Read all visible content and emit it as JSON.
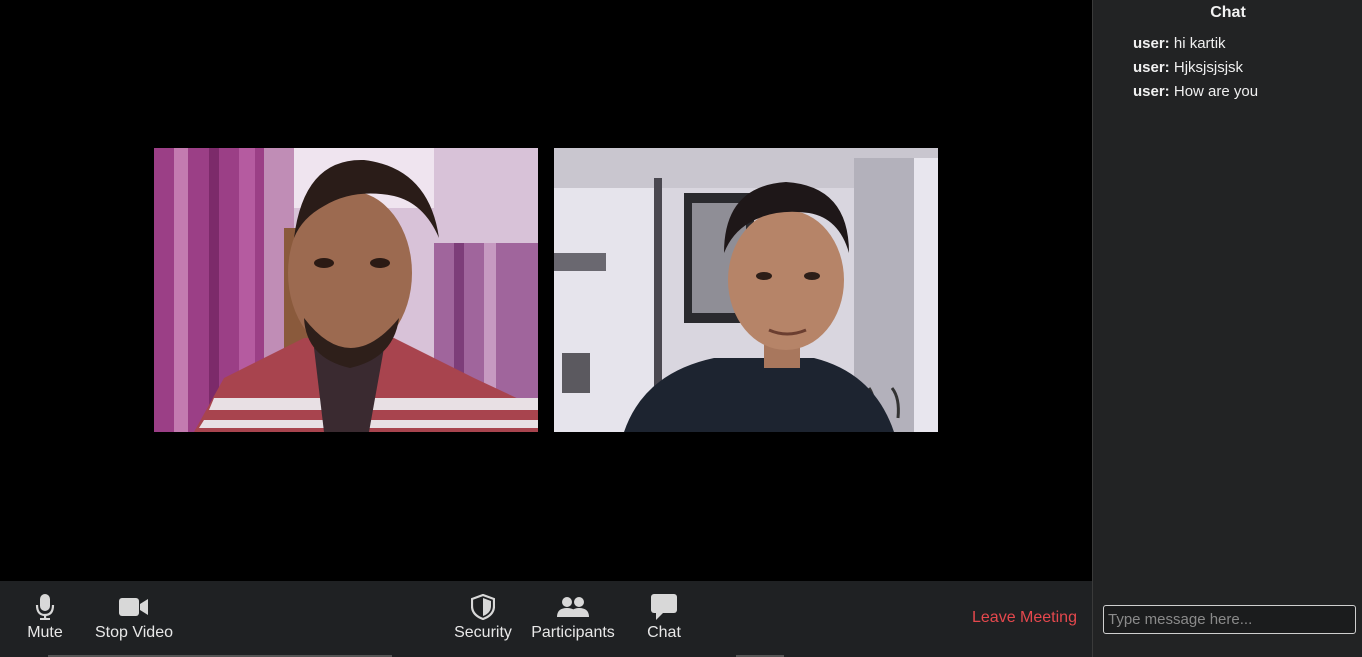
{
  "chat": {
    "title": "Chat",
    "messages": [
      {
        "user": "user:",
        "text": "hi kartik"
      },
      {
        "user": "user:",
        "text": "Hjksjsjsjsk"
      },
      {
        "user": "user:",
        "text": "How are you"
      }
    ],
    "input_placeholder": "Type message here..."
  },
  "toolbar": {
    "mute": {
      "label": "Mute",
      "icon": "microphone-icon"
    },
    "stop_video": {
      "label": "Stop Video",
      "icon": "video-camera-icon"
    },
    "security": {
      "label": "Security",
      "icon": "shield-icon"
    },
    "participants": {
      "label": "Participants",
      "icon": "people-icon"
    },
    "chat": {
      "label": "Chat",
      "icon": "chat-bubble-icon"
    },
    "leave": {
      "label": "Leave Meeting"
    }
  },
  "colors": {
    "stage_bg": "#000000",
    "toolbar_bg": "#1f2123",
    "panel_bg": "#222324",
    "leave_red": "#e5484d"
  }
}
